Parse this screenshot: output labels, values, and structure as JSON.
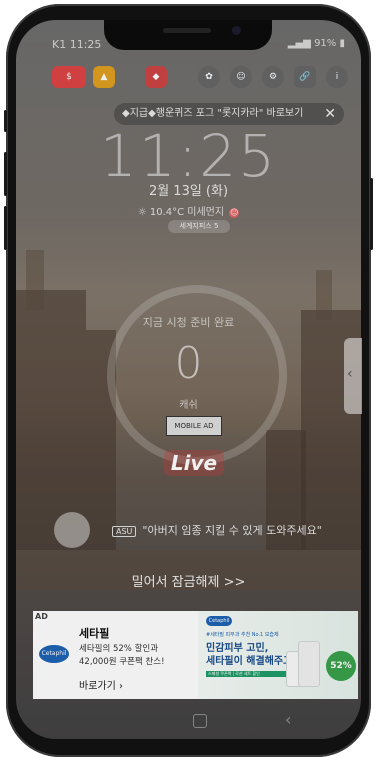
{
  "status": {
    "time": "K1 11:25",
    "battery": "91%"
  },
  "ticker": {
    "text": "◆지급◆행운퀴즈 포그 \"롯지카라\" 바로보기"
  },
  "lock": {
    "time": "11:25",
    "date": "2월 13일 (화)",
    "weather": "10.4°C 미세먼지",
    "dust_icon": "😐",
    "pill": "세계지피스 5",
    "ring_title": "지금 시청 준비 완료",
    "ring_number": "0",
    "ring_sub": "캐쉬",
    "badge": "MOBILE AD",
    "live": "Live",
    "hint_tag": "ASU",
    "hint": "\"아버지 임종 지킬 수 있게 도와주세요\"",
    "unlock": "밀어서 잠금해제 >>"
  },
  "ad": {
    "tag": "AD",
    "brand_logo": "Cetaphil",
    "title": "세타필",
    "desc_line1": "세타필의 52% 할인과",
    "desc_line2": "42,000원 쿠폰팩 찬스!",
    "cta": "바로가기 ›",
    "banner_small": "#세타필 피부과 추천 No.1 보습제",
    "banner_h1_line1": "민감피부 고민,",
    "banner_h1_line2": "세타필이 해결해주고",
    "banner_bar": "스페셜 쿠폰팩 | 로션 세트 할인",
    "banner_pct": "52%"
  },
  "colors": {
    "accent": "#1e63b5",
    "live": "#c83c3c",
    "green": "#3aa24b"
  }
}
